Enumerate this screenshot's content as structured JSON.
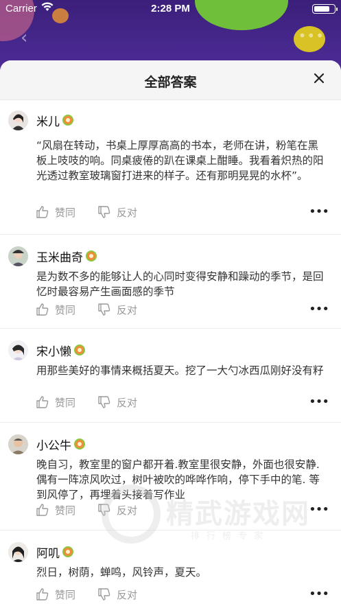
{
  "status_bar": {
    "carrier": "Carrier",
    "time": "2:28 PM"
  },
  "sheet": {
    "title": "全部答案"
  },
  "answers": [
    {
      "username": "米儿",
      "text": "“风扇在转动，书桌上厚厚高高的书本，老师在讲，粉笔在黑板上吱吱的响。同桌疲倦的趴在课桌上酣睡。我看着炽热的阳光透过教室玻璃窗打进来的样子。还有那明晃晃的水杯”。",
      "like_label": "赞同",
      "dislike_label": "反对"
    },
    {
      "username": "玉米曲奇",
      "text": "是为数不多的能够让人的心同时变得安静和躁动的季节，是回忆时最容易产生画面感的季节",
      "like_label": "赞同",
      "dislike_label": "反对"
    },
    {
      "username": "宋小懒",
      "text": "用那些美好的事情来概括夏天。挖了一大勺冰西瓜刚好没有籽",
      "like_label": "赞同",
      "dislike_label": "反对"
    },
    {
      "username": "小公牛",
      "text": "晚自习，教室里的窗户都开着.教室里很安静，外面也很安静.偶有一阵凉风吹过，树叶被吹的哗哗作响，停下手中的笔. 等到风停了，再埋着头接着写作业",
      "like_label": "赞同",
      "dislike_label": "反对"
    },
    {
      "username": "阿叽",
      "text": "烈日，树荫，蝉鸣，风铃声，夏天。",
      "like_label": "赞同",
      "dislike_label": "反对"
    }
  ],
  "watermark": {
    "title": "精武游戏网",
    "subtitle": "排行榜专家"
  }
}
